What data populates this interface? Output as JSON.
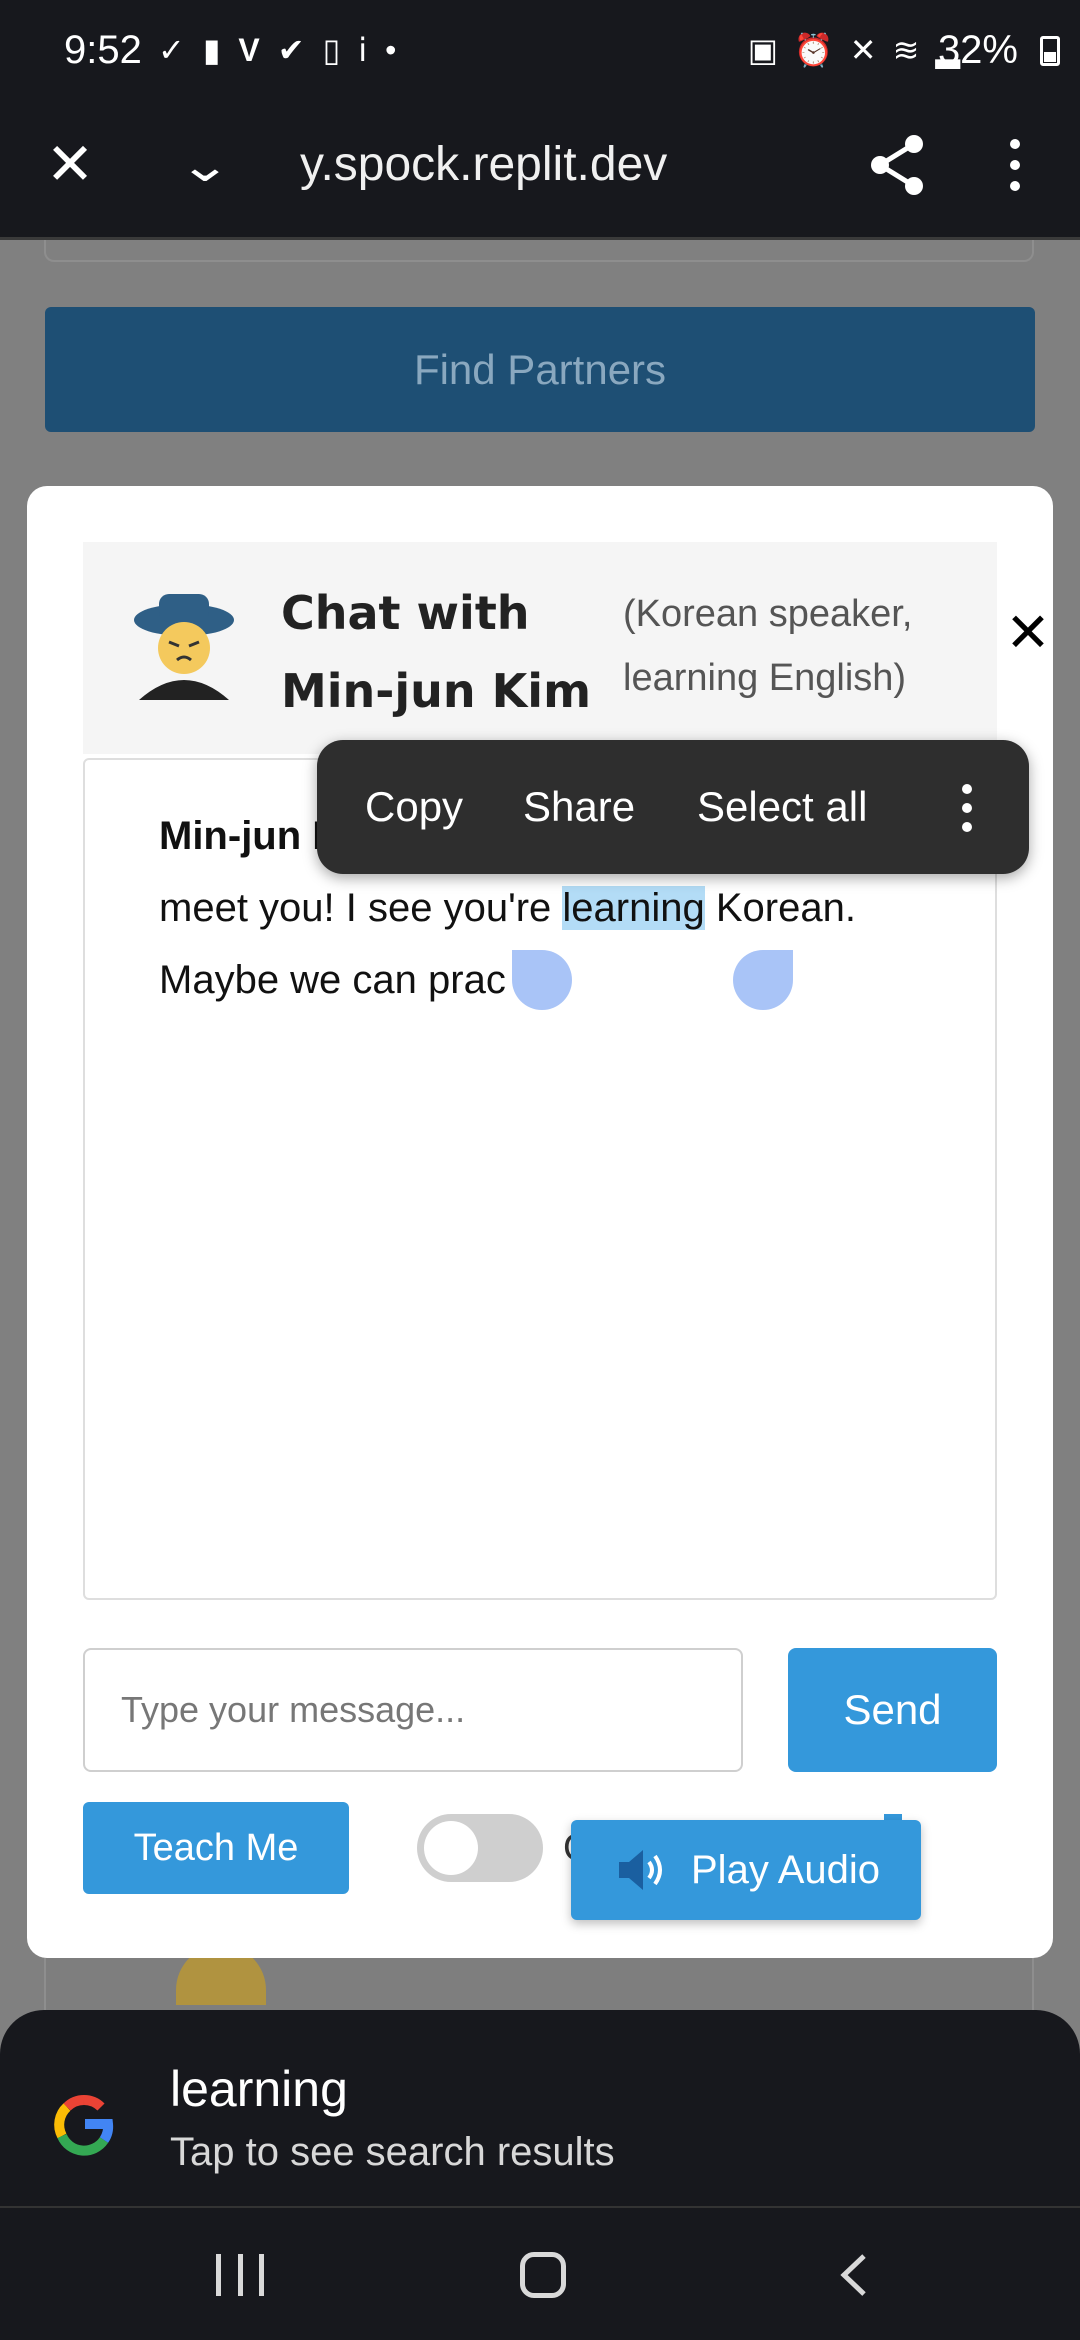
{
  "status_bar": {
    "time": "9:52",
    "battery": "32%"
  },
  "browser": {
    "url": "y.spock.replit.dev"
  },
  "page": {
    "find_partners_label": "Find Partners"
  },
  "chat": {
    "title": "Chat with Min-jun Kim",
    "subtitle": "(Korean speaker, learning English)",
    "close_glyph": "✕",
    "message": {
      "sender": "Min-jun K",
      "line1_before": "meet you! I see you're ",
      "line1_selected": "learning",
      "line1_after": " Korean.",
      "line2": "Maybe we can prac  e?"
    },
    "input_placeholder": "Type your message...",
    "send_label": "Send",
    "teach_label": "Teach Me",
    "toggle_label_partial": "C",
    "play_audio_label": "Play Audio"
  },
  "context_menu": {
    "items": [
      "Copy",
      "Share",
      "Select all"
    ]
  },
  "search_sheet": {
    "word": "learning",
    "hint": "Tap to see search results"
  },
  "icons": {
    "status_left": [
      "check-circle-icon",
      "notification-icon",
      "v-icon",
      "verified-icon",
      "clipboard-icon",
      "info-icon",
      "dot-icon"
    ],
    "status_right": [
      "battery-saver-icon",
      "alarm-icon",
      "mute-icon",
      "wifi-icon",
      "signal-icon"
    ]
  },
  "colors": {
    "primary_button": "#3498db",
    "find_partners_dimmed": "#1e4f74",
    "selection_highlight": "#b3dcf6",
    "selection_handle": "#a9c4f7",
    "system_bar": "#17181d"
  }
}
